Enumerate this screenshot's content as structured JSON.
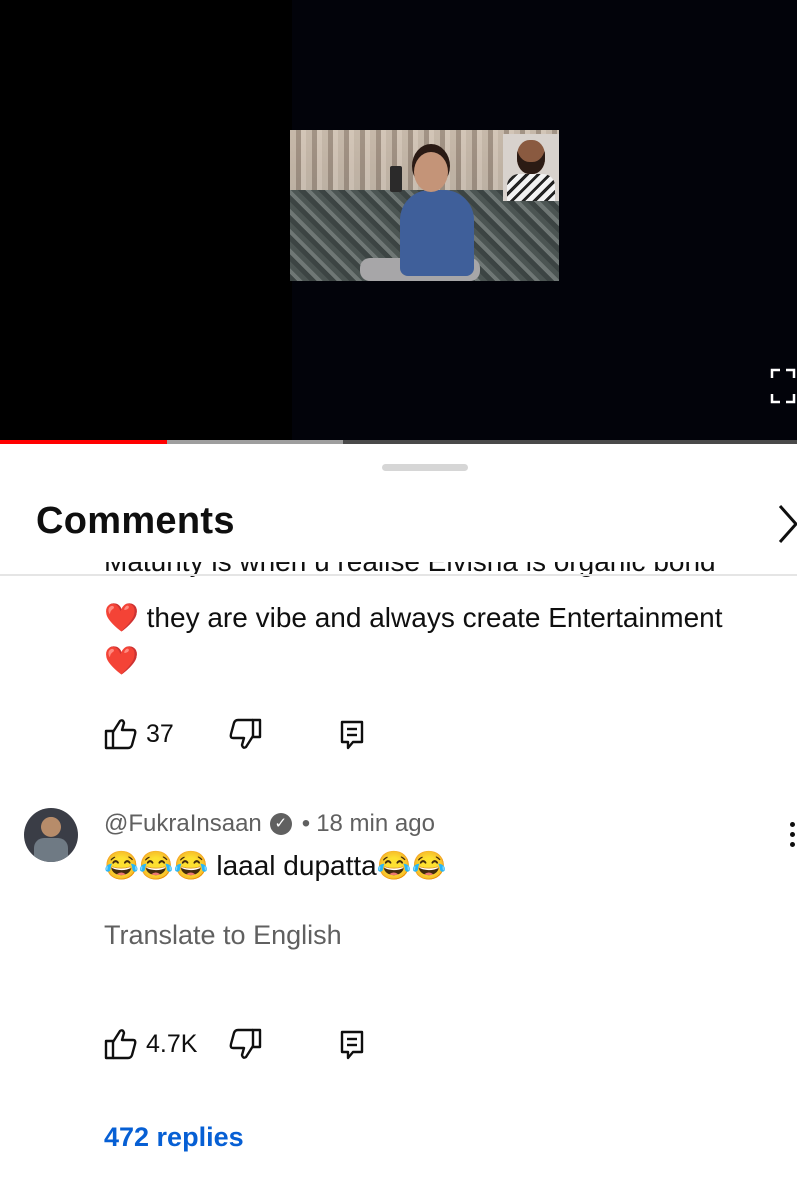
{
  "comments_panel": {
    "title": "Comments",
    "prev_comment": {
      "cut_line": "Maturity is when u realise Elvisha is organic bond",
      "text_line1": "❤️ they are vibe and always create Entertainment",
      "text_line2": "❤️",
      "like_count": "37"
    },
    "comment": {
      "author": "@FukraInsaan",
      "separator": "•",
      "time": "18 min ago",
      "emoji_prefix": "😂😂😂",
      "text": " laaal dupatta",
      "emoji_suffix": "😂😂",
      "translate_label": "Translate to English",
      "like_count": "4.7K",
      "replies_label": "472 replies"
    }
  },
  "icons": {
    "fullscreen": "fullscreen-icon",
    "chevron": "chevron-right-icon",
    "like": "thumbs-up-icon",
    "dislike": "thumbs-down-icon",
    "reply": "reply-comment-icon",
    "verified": "verified-check-icon",
    "more": "more-vertical-icon"
  },
  "player": {
    "played_fraction": 0.21,
    "buffered_fraction": 0.43
  },
  "colors": {
    "accent_red": "#ff0000",
    "link_blue": "#065fd4",
    "secondary_text": "#606060"
  }
}
